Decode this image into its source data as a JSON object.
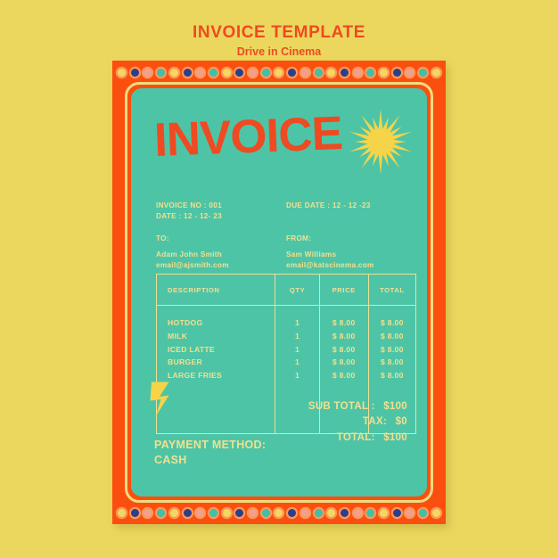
{
  "page": {
    "title": "INVOICE TEMPLATE",
    "subtitle": "Drive in Cinema",
    "background_color": "#ecd75e",
    "accent_color": "#ef4a21",
    "frame_color": "#fb4f0f",
    "content_color": "#4ec4a6",
    "text_color": "#f1e08f"
  },
  "invoice": {
    "heading": "INVOICE",
    "meta": {
      "invoice_no": "INVOICE NO : 001",
      "date": "DATE : 12 - 12- 23",
      "due_date": "DUE DATE : 12 - 12 -23",
      "to_label": "TO:",
      "to_name": "Adam John Smith",
      "to_email": "email@ajsmith.com",
      "from_label": "FROM:",
      "from_name": "Sam Williams",
      "from_email": "email@katscinema.com"
    },
    "table": {
      "headers": {
        "description": "DESCRIPTION",
        "qty": "QTY",
        "price": "PRICE",
        "total": "TOTAL"
      },
      "rows": [
        {
          "description": "HOTDOG",
          "qty": "1",
          "price": "$ 8.00",
          "total": "$ 8.00"
        },
        {
          "description": "MILK",
          "qty": "1",
          "price": "$ 8.00",
          "total": "$ 8.00"
        },
        {
          "description": "ICED LATTE",
          "qty": "1",
          "price": "$ 8.00",
          "total": "$ 8.00"
        },
        {
          "description": "BURGER",
          "qty": "1",
          "price": "$ 8.00",
          "total": "$ 8.00"
        },
        {
          "description": "LARGE FRIES",
          "qty": "1",
          "price": "$ 8.00",
          "total": "$ 8.00"
        }
      ]
    },
    "totals": {
      "subtotal_label": "SUB TOTAL :",
      "subtotal_value": "$100",
      "tax_label": "TAX:",
      "tax_value": "$0",
      "total_label": "TOTAL:",
      "total_value": "$100"
    },
    "payment": {
      "label": "PAYMENT METHOD:",
      "value": "CASH"
    },
    "decor": {
      "sun_icon": "sun-starburst-icon",
      "bolt_icon": "lightning-bolt-icon",
      "dot_colors": [
        "#f2d85f",
        "#2b3f8c",
        "#f2a08e",
        "#3fc0a8"
      ],
      "dot_count": 25
    }
  }
}
